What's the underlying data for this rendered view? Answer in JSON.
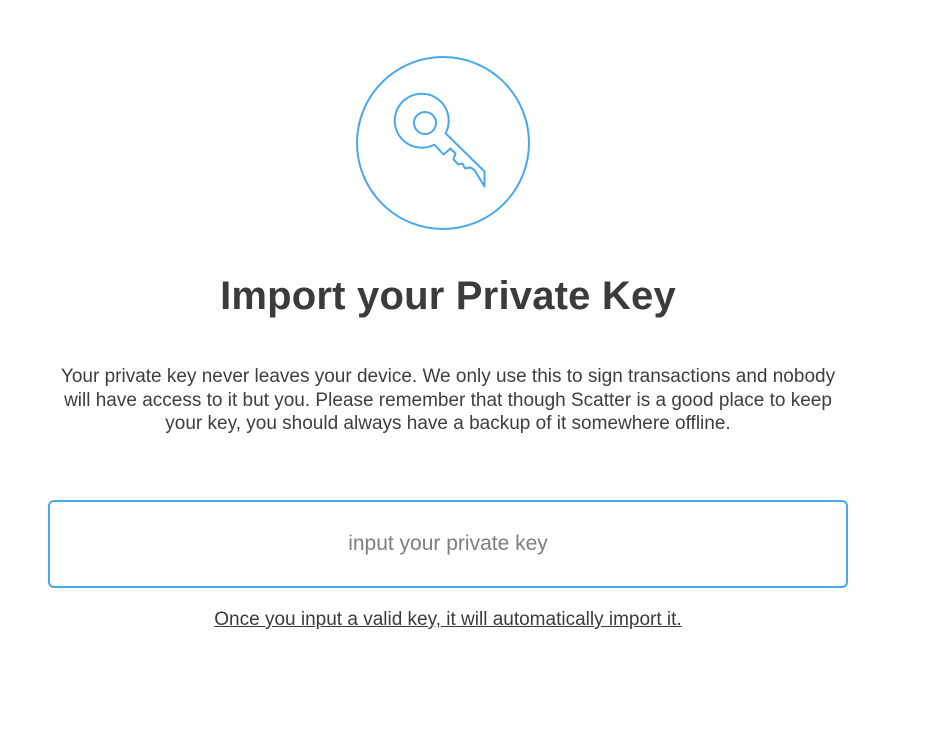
{
  "icon": {
    "name": "key-icon",
    "accent_color": "#4aa8ea"
  },
  "header": {
    "title": "Import your Private Key"
  },
  "main": {
    "description": "Your private key never leaves your device. We only use this to sign transactions and nobody will have access to it but you. Please remember that though Scatter is a good place to keep your key, you should always have a backup of it somewhere offline.",
    "private_key_input": {
      "value": "",
      "placeholder": "input your private key"
    },
    "hint": "Once you input a valid key, it will automatically import it."
  }
}
